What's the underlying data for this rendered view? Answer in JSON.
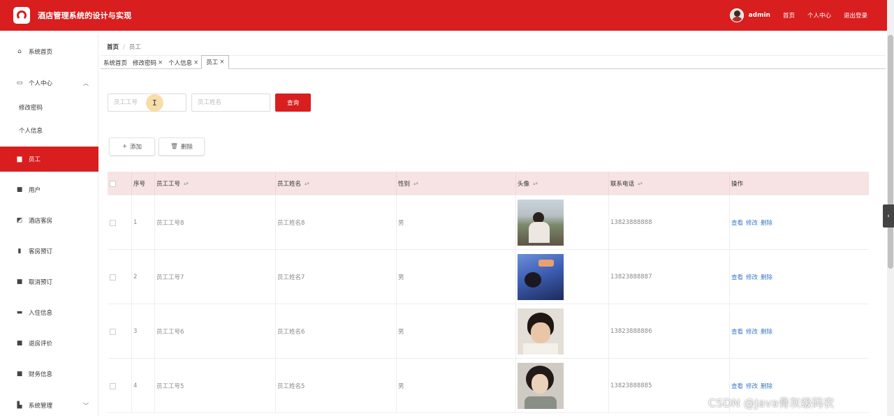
{
  "header": {
    "title": "酒店管理系统的设计与实现",
    "username": "admin",
    "links": [
      "首页",
      "个人中心",
      "退出登录"
    ]
  },
  "sidebar": {
    "items": [
      {
        "label": "系统首页",
        "icon": "home-icon"
      },
      {
        "label": "个人中心",
        "icon": "profile-icon",
        "children": [
          "修改密码",
          "个人信息"
        ]
      },
      {
        "label": "员工",
        "icon": "briefcase-icon",
        "active": true
      },
      {
        "label": "用户",
        "icon": "grid-icon"
      },
      {
        "label": "酒店客房",
        "icon": "chart-icon"
      },
      {
        "label": "客房预订",
        "icon": "clipboard-icon"
      },
      {
        "label": "取消预订",
        "icon": "grid-icon"
      },
      {
        "label": "入住信息",
        "icon": "ticket-icon"
      },
      {
        "label": "退房评价",
        "icon": "grid-icon"
      },
      {
        "label": "财务信息",
        "icon": "grid-icon"
      },
      {
        "label": "系统管理",
        "icon": "bars-icon"
      }
    ]
  },
  "breadcrumb": {
    "home": "首页",
    "sep": "/",
    "current": "员工"
  },
  "tabs": [
    {
      "label": "系统首页",
      "closable": false
    },
    {
      "label": "修改密码",
      "closable": true
    },
    {
      "label": "个人信息",
      "closable": true
    },
    {
      "label": "员工",
      "closable": true,
      "active": true
    }
  ],
  "search": {
    "id_placeholder": "员工工号",
    "name_placeholder": "员工姓名",
    "query_label": "查询"
  },
  "actions": {
    "add_label": "添加",
    "delete_label": "删除"
  },
  "table": {
    "columns": [
      "",
      "序号",
      "员工工号",
      "员工姓名",
      "性别",
      "头像",
      "联系电话",
      "操作"
    ],
    "rows": [
      {
        "index": "1",
        "id": "员工工号8",
        "name": "员工姓名8",
        "gender": "男",
        "phone": "13823888888"
      },
      {
        "index": "2",
        "id": "员工工号7",
        "name": "员工姓名7",
        "gender": "男",
        "phone": "13823888887"
      },
      {
        "index": "3",
        "id": "员工工号6",
        "name": "员工姓名6",
        "gender": "男",
        "phone": "13823888886"
      },
      {
        "index": "4",
        "id": "员工工号5",
        "name": "员工姓名5",
        "gender": "男",
        "phone": "13823888885"
      }
    ],
    "ops": [
      "查看",
      "修改",
      "删除"
    ]
  },
  "watermark": "CSDN @Java骨灰级码农",
  "colors": {
    "primary": "#d81e1e",
    "header_row": "#f7e3e3",
    "link": "#3a7bc8"
  }
}
